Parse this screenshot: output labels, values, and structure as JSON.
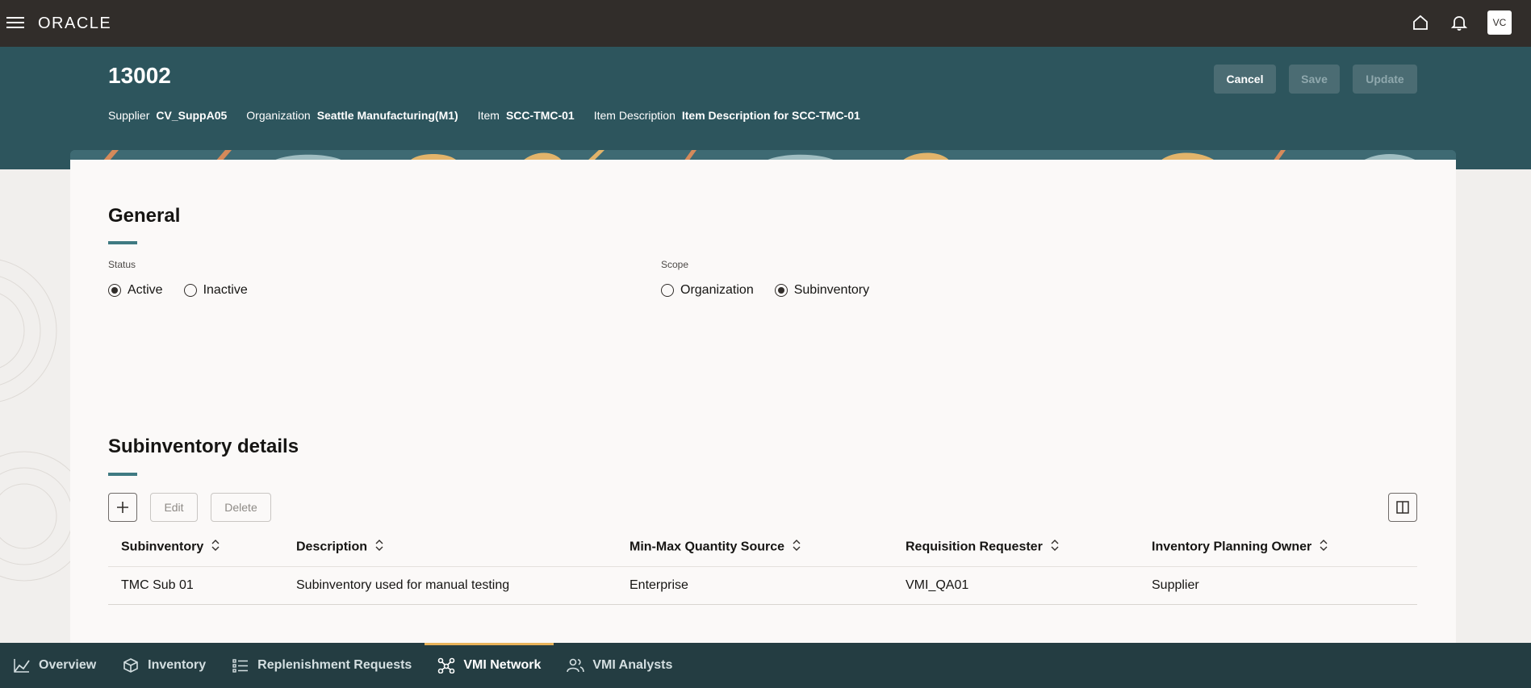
{
  "app": {
    "logo": "ORACLE",
    "user_initials": "VC"
  },
  "header": {
    "title": "13002",
    "meta": [
      {
        "label": "Supplier",
        "value": "CV_SuppA05"
      },
      {
        "label": "Organization",
        "value": "Seattle Manufacturing(M1)"
      },
      {
        "label": "Item",
        "value": "SCC-TMC-01"
      },
      {
        "label": "Item Description",
        "value": "Item Description for SCC-TMC-01"
      }
    ],
    "buttons": {
      "cancel": "Cancel",
      "save": "Save",
      "update": "Update"
    }
  },
  "general": {
    "title": "General",
    "status": {
      "label": "Status",
      "options": [
        "Active",
        "Inactive"
      ],
      "selected": "Active"
    },
    "scope": {
      "label": "Scope",
      "options": [
        "Organization",
        "Subinventory"
      ],
      "selected": "Subinventory"
    }
  },
  "subinventory": {
    "title": "Subinventory details",
    "toolbar": {
      "edit": "Edit",
      "delete": "Delete"
    },
    "columns": [
      "Subinventory",
      "Description",
      "Min-Max Quantity Source",
      "Requisition Requester",
      "Inventory Planning Owner"
    ],
    "rows": [
      [
        "TMC Sub 01",
        "Subinventory used for manual testing",
        "Enterprise",
        "VMI_QA01",
        "Supplier"
      ]
    ]
  },
  "bottom_nav": {
    "items": [
      {
        "label": "Overview",
        "icon": "chart-line-icon"
      },
      {
        "label": "Inventory",
        "icon": "box-icon"
      },
      {
        "label": "Replenishment Requests",
        "icon": "list-icon"
      },
      {
        "label": "VMI Network",
        "icon": "network-icon"
      },
      {
        "label": "VMI Analysts",
        "icon": "users-icon"
      }
    ],
    "active": "VMI Network"
  },
  "colors": {
    "topbar": "#312d2a",
    "header": "#2d555d",
    "accent": "#3f7a82",
    "nav": "#243d42",
    "nav_active": "#e8b35a"
  }
}
